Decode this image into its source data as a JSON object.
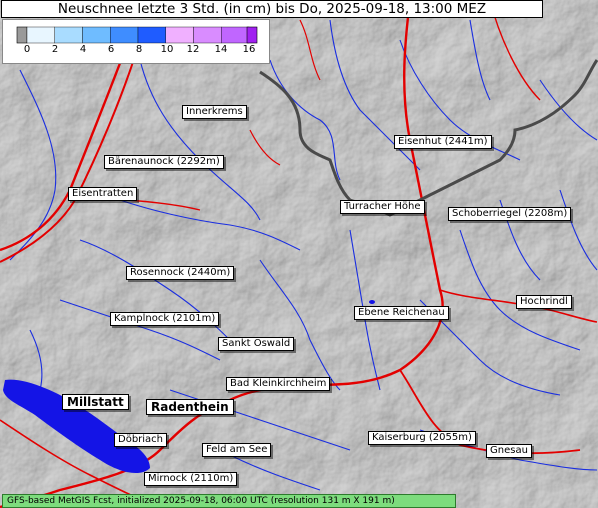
{
  "title": "Neuschnee letzte 3 Std. (in cm) bis Do, 2025-09-18, 13:00 MEZ",
  "legend": {
    "ticks": [
      "0",
      "2",
      "4",
      "6",
      "8",
      "10",
      "12",
      "14",
      "16"
    ],
    "colors": [
      "#e8f6ff",
      "#a9dcff",
      "#6fbcff",
      "#3f8dff",
      "#1f5cff",
      "#f0b0ff",
      "#d98cff",
      "#c066ff",
      "#a020f0"
    ]
  },
  "places": [
    {
      "name": "Innerkrems"
    },
    {
      "name": "Bärenaunock (2292m)"
    },
    {
      "name": "Eisentratten"
    },
    {
      "name": "Eisenhut (2441m)"
    },
    {
      "name": "Turracher Höhe"
    },
    {
      "name": "Schoberriegel (2208m)"
    },
    {
      "name": "Rosennock (2440m)"
    },
    {
      "name": "Kamplnock (2101m)"
    },
    {
      "name": "Ebene Reichenau"
    },
    {
      "name": "Hochrindl"
    },
    {
      "name": "Sankt Oswald"
    },
    {
      "name": "Bad Kleinkirchheim"
    },
    {
      "name": "Millstatt"
    },
    {
      "name": "Radenthein"
    },
    {
      "name": "Döbriach"
    },
    {
      "name": "Feld am See"
    },
    {
      "name": "Kaiserburg (2055m)"
    },
    {
      "name": "Gnesau"
    },
    {
      "name": "Mirnock (2110m)"
    }
  ],
  "footer": "GFS-based MetGIS Fcst, initialized 2025-09-18, 06:00 UTC  (resolution 131 m X 191 m)"
}
